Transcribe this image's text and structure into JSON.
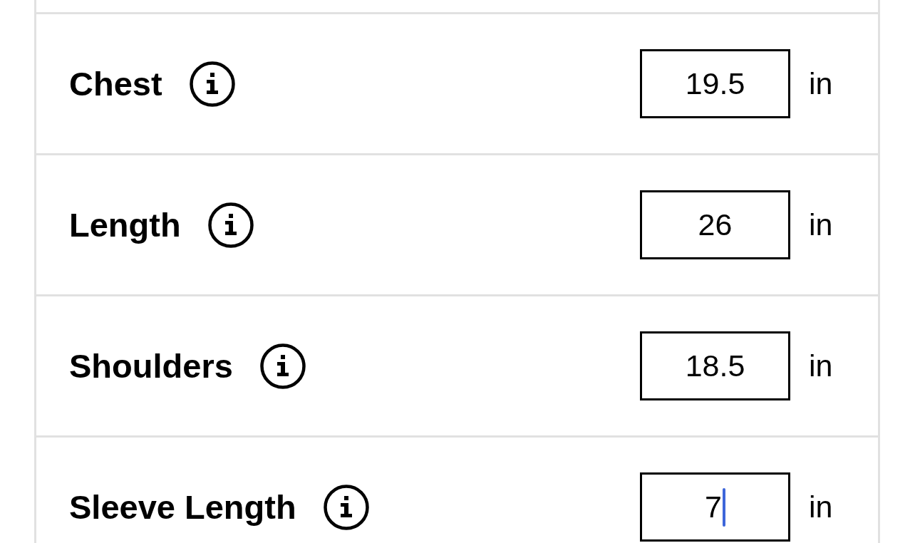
{
  "rows": [
    {
      "label": "Chest",
      "value": "19.5",
      "unit": "in",
      "focused": false
    },
    {
      "label": "Length",
      "value": "26",
      "unit": "in",
      "focused": false
    },
    {
      "label": "Shoulders",
      "value": "18.5",
      "unit": "in",
      "focused": false
    },
    {
      "label": "Sleeve Length",
      "value": "7",
      "unit": "in",
      "focused": true
    }
  ]
}
